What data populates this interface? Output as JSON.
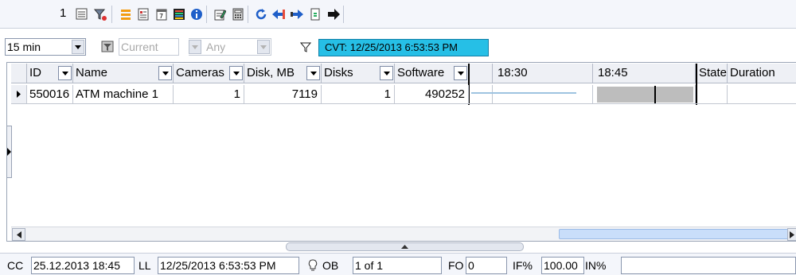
{
  "toolbar": {
    "counter": "1",
    "icons": [
      "list-icon",
      "wrench-filter-icon",
      "orange-bars-icon",
      "notepad-icon",
      "calendar-icon",
      "color-palette-icon",
      "info-icon",
      "edit-sheet-icon",
      "calculator-icon",
      "refresh-icon",
      "arrow-left-icon",
      "arrow-right-icon",
      "document-icon",
      "arrow-forward-icon"
    ]
  },
  "filters": {
    "interval": "15 min",
    "camera": "Current",
    "state": "Any",
    "cvt": "CVT: 12/25/2013 6:53:53 PM"
  },
  "grid": {
    "columns": {
      "id": "ID",
      "name": "Name",
      "cameras": "Cameras",
      "disk": "Disk, MB",
      "disks": "Disks",
      "software": "Software",
      "t1": "18:30",
      "t2": "18:45",
      "state": "State",
      "duration": "Duration"
    },
    "rows": [
      {
        "id": "550016",
        "name": "ATM machine 1",
        "cameras": "1",
        "disk": "7119",
        "disks": "1",
        "software": "490252"
      }
    ]
  },
  "status": {
    "cc_label": "CC",
    "cc_value": "25.12.2013 18:45",
    "ll_label": "LL",
    "ll_value": "12/25/2013 6:53:53 PM",
    "ob_label": "OB",
    "ob_value": "1 of 1",
    "fo_label": "FO",
    "fo_value": "0",
    "if_label": "IF%",
    "if_value": "100.00",
    "in_label": "IN%",
    "in_value": ""
  },
  "colors": {
    "accent": "#26bfe6",
    "toolbar": "#f4f6fb"
  }
}
